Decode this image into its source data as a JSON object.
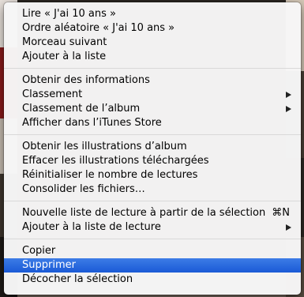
{
  "menu": {
    "groups": [
      [
        {
          "label": "Lire « J'ai 10 ans »"
        },
        {
          "label": "Ordre aléatoire « J'ai 10 ans »"
        },
        {
          "label": "Morceau suivant"
        },
        {
          "label": "Ajouter à la liste"
        }
      ],
      [
        {
          "label": "Obtenir des informations"
        },
        {
          "label": "Classement"
        },
        {
          "label": "Classement de l’album"
        },
        {
          "label": "Afficher dans l’iTunes Store"
        }
      ],
      [
        {
          "label": "Obtenir les illustrations d’album"
        },
        {
          "label": "Effacer les illustrations téléchargées"
        },
        {
          "label": "Réinitialiser le nombre de lectures"
        },
        {
          "label": "Consolider les fichiers…"
        }
      ],
      [
        {
          "label": "Nouvelle liste de lecture à partir de la sélection",
          "shortcut": "⌘N"
        },
        {
          "label": "Ajouter à la liste de lecture"
        }
      ],
      [
        {
          "label": "Copier"
        },
        {
          "label": "Supprimer"
        },
        {
          "label": "Décocher la sélection"
        }
      ]
    ],
    "highlighted": "Supprimer"
  }
}
